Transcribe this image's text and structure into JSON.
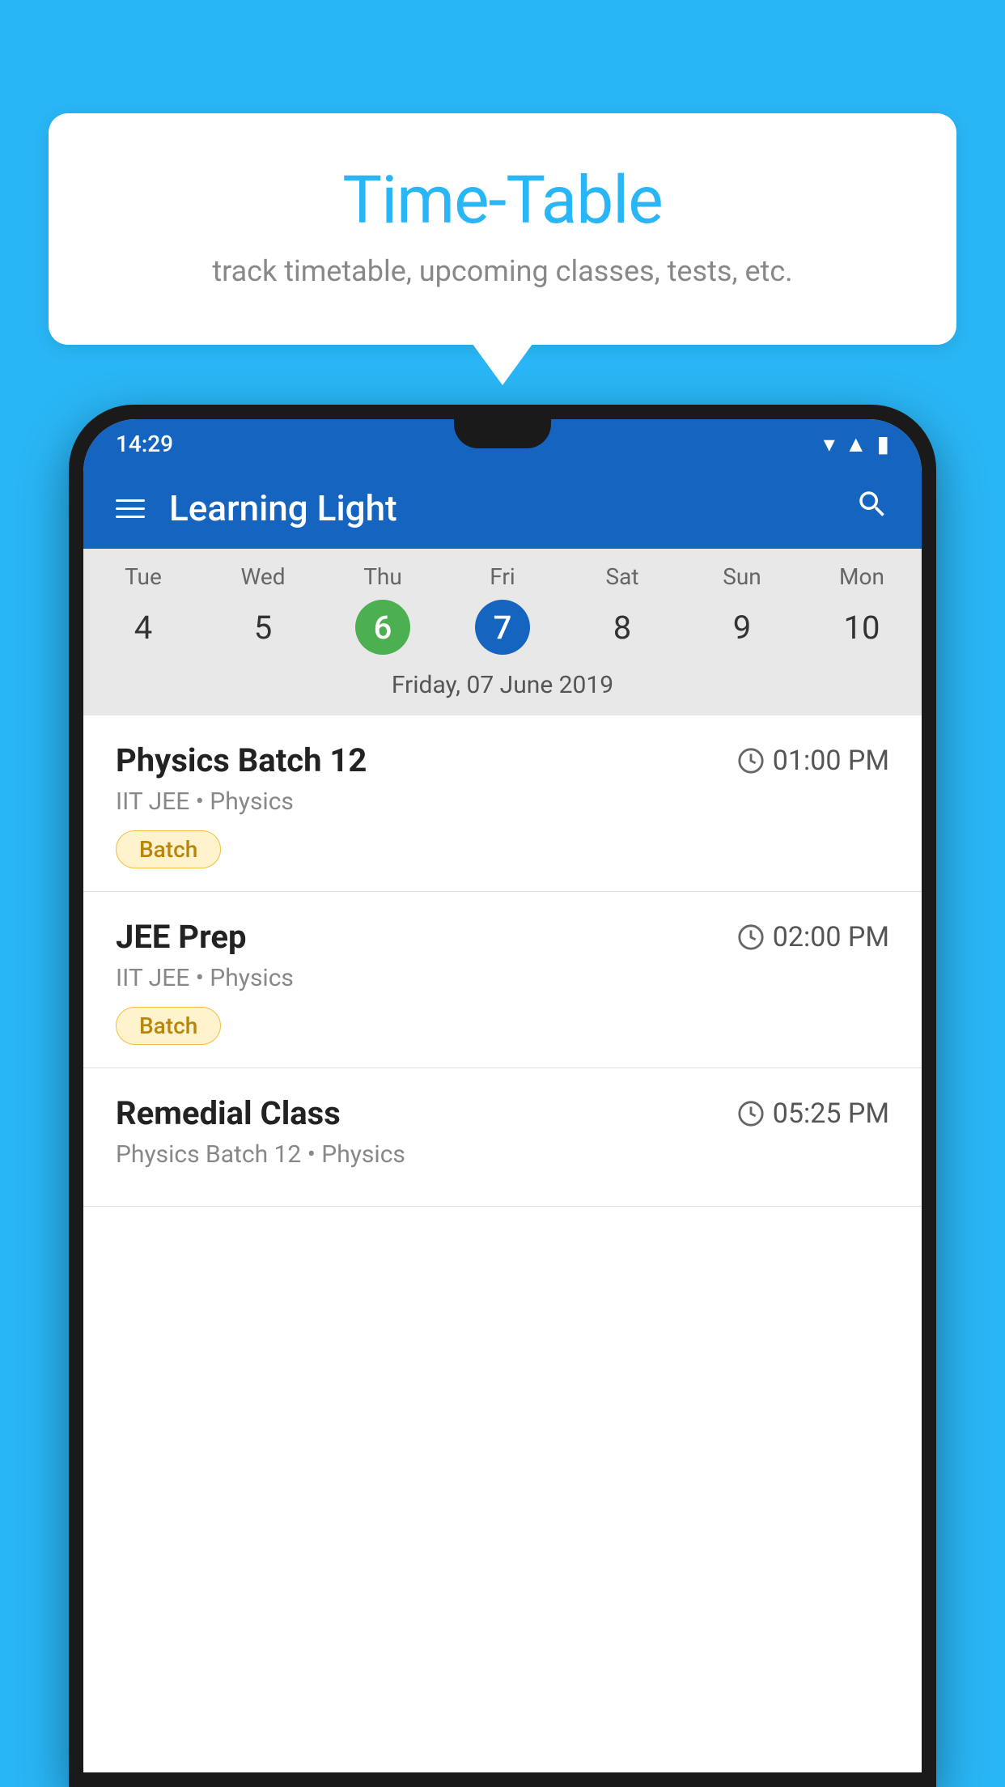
{
  "background_color": "#29B6F6",
  "bubble": {
    "title": "Time-Table",
    "subtitle": "track timetable, upcoming classes, tests, etc."
  },
  "status_bar": {
    "time": "14:29",
    "icons": [
      "wifi",
      "signal",
      "battery"
    ]
  },
  "app_bar": {
    "title": "Learning Light"
  },
  "calendar": {
    "days": [
      {
        "name": "Tue",
        "number": "4",
        "state": "normal"
      },
      {
        "name": "Wed",
        "number": "5",
        "state": "normal"
      },
      {
        "name": "Thu",
        "number": "6",
        "state": "today"
      },
      {
        "name": "Fri",
        "number": "7",
        "state": "selected"
      },
      {
        "name": "Sat",
        "number": "8",
        "state": "normal"
      },
      {
        "name": "Sun",
        "number": "9",
        "state": "normal"
      },
      {
        "name": "Mon",
        "number": "10",
        "state": "normal"
      }
    ],
    "selected_date_label": "Friday, 07 June 2019"
  },
  "schedule": {
    "items": [
      {
        "title": "Physics Batch 12",
        "time": "01:00 PM",
        "subject": "IIT JEE • Physics",
        "badge": "Batch"
      },
      {
        "title": "JEE Prep",
        "time": "02:00 PM",
        "subject": "IIT JEE • Physics",
        "badge": "Batch"
      },
      {
        "title": "Remedial Class",
        "time": "05:25 PM",
        "subject": "Physics Batch 12 • Physics",
        "badge": null
      }
    ]
  }
}
